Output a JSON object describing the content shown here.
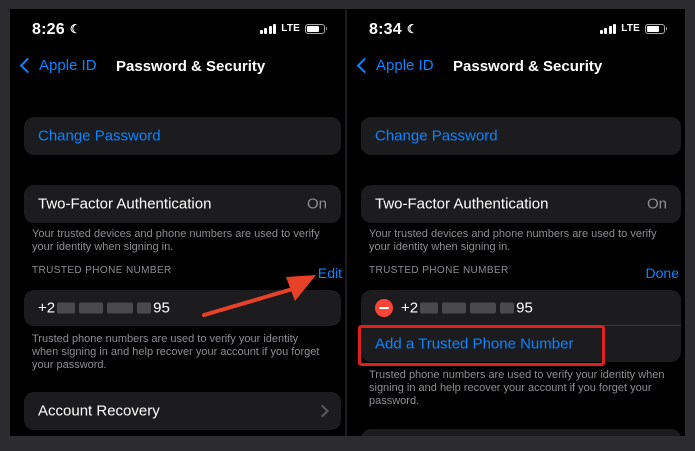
{
  "left": {
    "status": {
      "time": "8:26",
      "network": "LTE"
    },
    "nav": {
      "back_label": "Apple ID",
      "title": "Password & Security"
    },
    "change_password": "Change Password",
    "two_factor": {
      "label": "Two-Factor Authentication",
      "value": "On"
    },
    "two_factor_note": "Your trusted devices and phone numbers are used to verify your identity when signing in.",
    "trusted_header": "TRUSTED PHONE NUMBER",
    "edit_label": "Edit",
    "phone": {
      "prefix": "+2",
      "suffix": "95"
    },
    "phone_note": "Trusted phone numbers are used to verify your identity when signing in and help recover your account if you forget your password.",
    "account_recovery": "Account Recovery"
  },
  "right": {
    "status": {
      "time": "8:34",
      "network": "LTE"
    },
    "nav": {
      "back_label": "Apple ID",
      "title": "Password & Security"
    },
    "change_password": "Change Password",
    "two_factor": {
      "label": "Two-Factor Authentication",
      "value": "On"
    },
    "two_factor_note": "Your trusted devices and phone numbers are used to verify your identity when signing in.",
    "trusted_header": "TRUSTED PHONE NUMBER",
    "done_label": "Done",
    "phone": {
      "prefix": "+2",
      "suffix": "95"
    },
    "add_number": "Add a Trusted Phone Number",
    "phone_note": "Trusted phone numbers are used to verify your identity when signing in and help recover your account if you forget your password."
  },
  "colors": {
    "accent": "#0a84ff",
    "annotation": "#e8412a",
    "destructive": "#ff453a"
  }
}
